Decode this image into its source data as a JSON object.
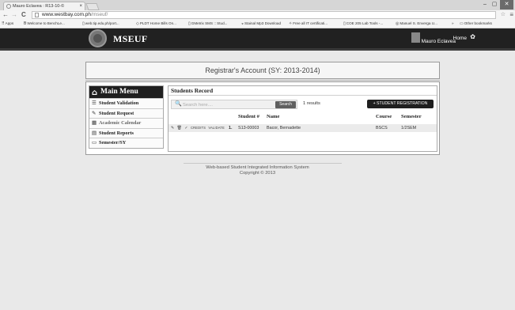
{
  "browser": {
    "tab_title": "Mauro Eclavea : R13-10-©",
    "tab_close": "×",
    "window_controls": {
      "minimize": "–",
      "maximize": "▢",
      "close": "✕"
    },
    "nav": {
      "back": "←",
      "forward": "→",
      "reload": "C"
    },
    "url_host": "www.westbay.com.ph",
    "url_path": "/mseuf/",
    "bookmarks": [
      {
        "icon": "apps-icon",
        "glyph": "⠿",
        "label": "Apps"
      },
      {
        "icon": "b-icon",
        "glyph": "B",
        "label": "Welcome to BenchLe..."
      },
      {
        "icon": "page-icon",
        "glyph": "▯",
        "label": "web.tip.edu.ph/port..."
      },
      {
        "icon": "pldt-icon",
        "glyph": "◇",
        "label": "PLDT Home Bills On..."
      },
      {
        "icon": "page-icon",
        "glyph": "▯",
        "label": "GMetrix SMS :: Stud..."
      },
      {
        "icon": "download-icon",
        "glyph": "◒",
        "label": "Stainal Mp3 Download"
      },
      {
        "icon": "cert-icon",
        "glyph": "✧",
        "label": "Free all IT certificati..."
      },
      {
        "icon": "page-icon",
        "glyph": "▯",
        "label": "COE 205 Lab Tools -..."
      },
      {
        "icon": "profile-icon",
        "glyph": "◎",
        "label": "Manuel S. Enverga U..."
      },
      {
        "icon": "more-icon",
        "glyph": "»",
        "label": ""
      },
      {
        "icon": "folder-icon",
        "glyph": "▭",
        "label": "Other bookmarks"
      }
    ]
  },
  "site": {
    "name": "MSEUF",
    "user_name": "Mauro Eclavea",
    "home_label": "Home",
    "gear_glyph": "✿"
  },
  "page": {
    "title": "Registrar's Account (SY: 2013-2014)"
  },
  "menu": {
    "header": "Main Menu",
    "items": [
      {
        "label": "Student Validation",
        "glyph": "☰"
      },
      {
        "label": "Student Request",
        "glyph": "✎"
      },
      {
        "label": "Academic Calendar",
        "glyph": "▦"
      },
      {
        "label": "Student Reports",
        "glyph": "▤"
      },
      {
        "label": "Semester/SY",
        "glyph": "▭"
      }
    ]
  },
  "records": {
    "title": "Students Record",
    "search_placeholder": "Search here....",
    "search_button": "Search",
    "results": "1 results",
    "register_button": "+ STUDENT REGISTRATION",
    "columns": {
      "student_no": "Student #",
      "name": "Name",
      "course": "Course",
      "semester": "Semester"
    },
    "rows": [
      {
        "actions": {
          "edit": "✎",
          "delete": "🗑",
          "check": "✓",
          "credits": "CREDITS",
          "validate": "VALIDATE"
        },
        "num": "1.",
        "student_no": "S13-00003",
        "name": "Bacor, Bernadette",
        "course": "BSCS",
        "semester": "1/2SEM"
      }
    ]
  },
  "footer": {
    "line1": "Web-based Student Integrated Information System",
    "line2": "Copyright © 2013"
  }
}
